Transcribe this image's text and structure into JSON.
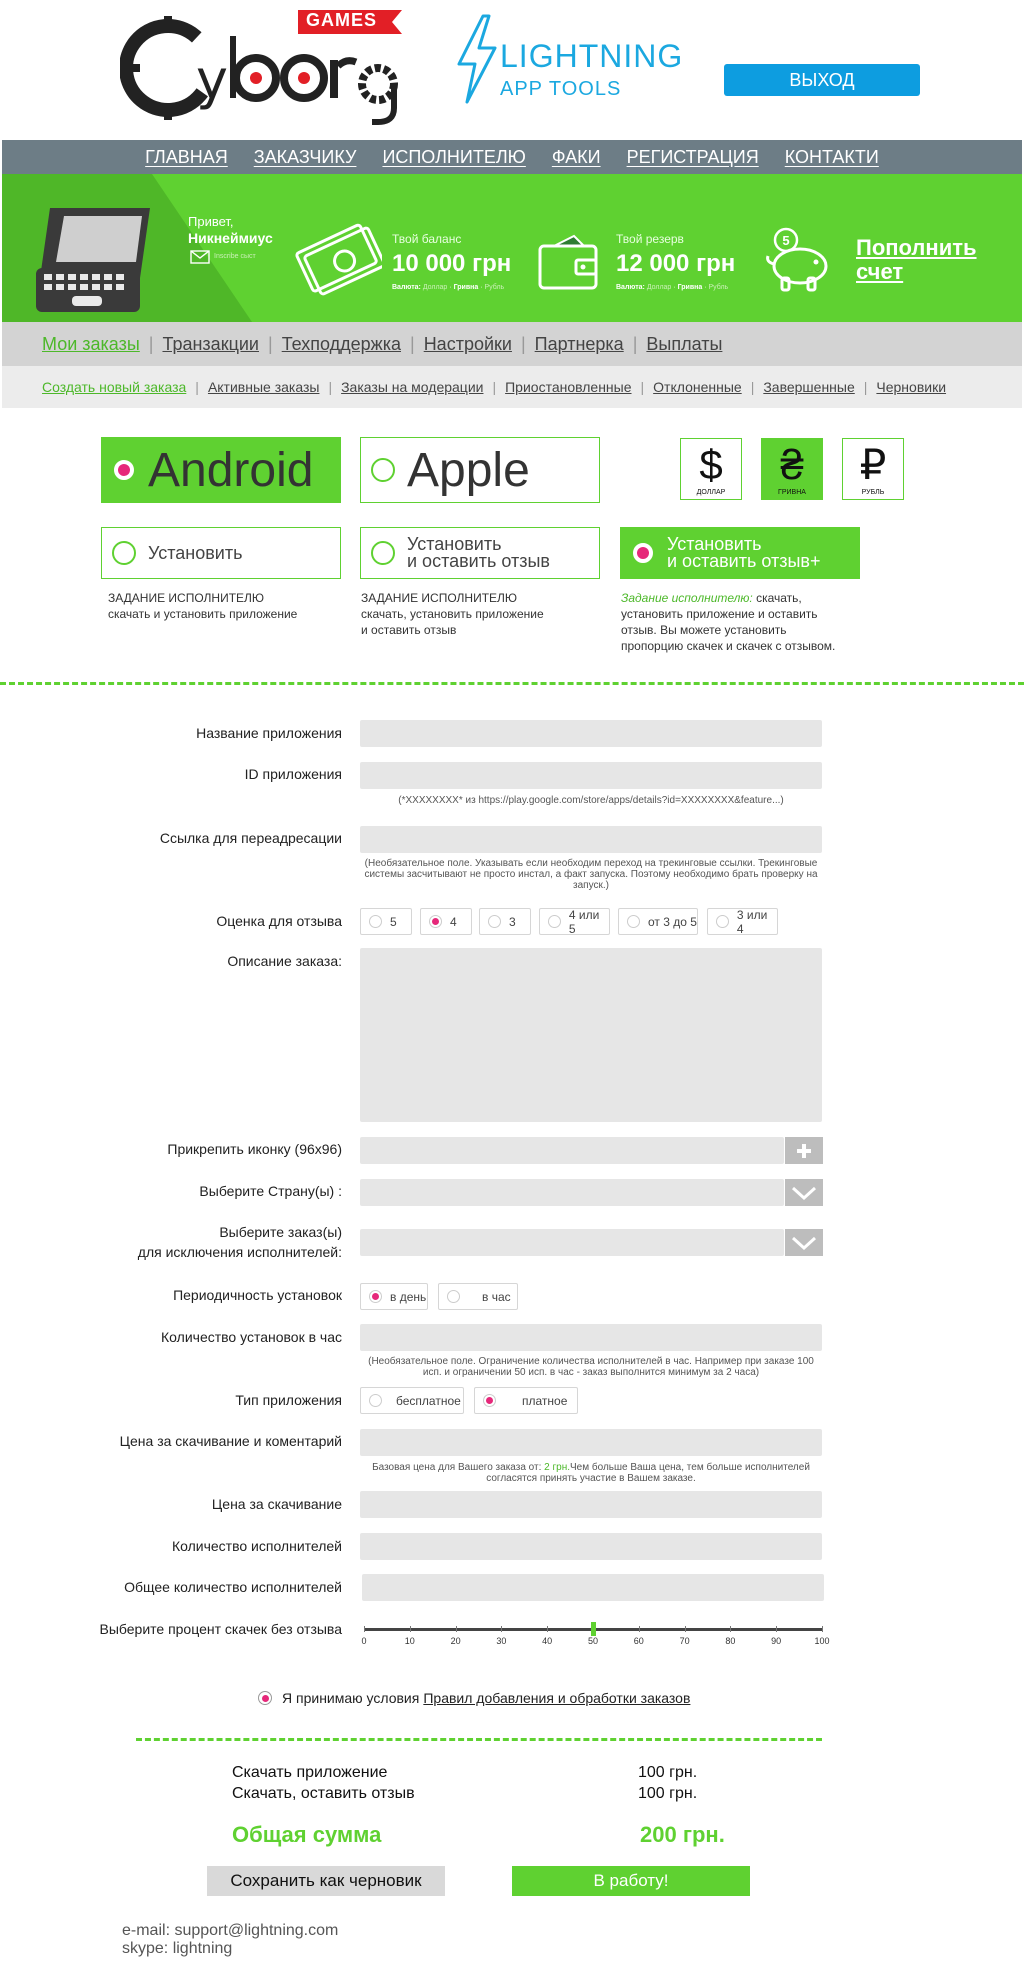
{
  "header": {
    "cyborg_logo_text": "Cyborg",
    "cyborg_logo_badge": "GAMES",
    "lightning_title": "LIGHTNING",
    "lightning_subtitle": "APP TOOLS",
    "logout_label": "ВЫХОД",
    "accent_color": "#1ba8e0"
  },
  "nav": {
    "items": [
      "ГЛАВНАЯ",
      "ЗАКАЗЧИКУ",
      "ИСПОЛНИТЕЛЮ",
      "ФАКИ",
      "РЕГИСТРАЦИЯ",
      "КОНТАКТИ"
    ]
  },
  "profile": {
    "greeting": "Привет,",
    "nickname": "Никнеймиус",
    "mail_caption": "Inscribe сыст"
  },
  "balance": {
    "label": "Твой баланс",
    "value": "10 000 грн",
    "currency_prefix": "Валюта:",
    "currency_opt1": "Доллар",
    "currency_opt2": "Гривна",
    "currency_opt3": "Рубль"
  },
  "reserve": {
    "label": "Твой резерв",
    "value": "12 000 грн",
    "currency_prefix": "Валюта:",
    "currency_opt1": "Доллар",
    "currency_opt2": "Гривна",
    "currency_opt3": "Рубль",
    "piggy_badge": "5"
  },
  "topup_label": "Пополнить счет",
  "subnav1": {
    "items": [
      "Мои заказы",
      "Транзакции",
      "Техподдержка",
      "Настройки",
      "Партнерка",
      "Выплаты"
    ]
  },
  "subnav2": {
    "items": [
      "Создать новый заказа",
      "Активные заказы",
      "Заказы на модерации",
      "Приостановленные",
      "Отклоненные",
      "Завершенные",
      "Черновики"
    ]
  },
  "platforms": {
    "android": "Android",
    "apple": "Apple",
    "selected": "Android"
  },
  "currencies": [
    {
      "symbol": "$",
      "name": "ДОЛЛАР",
      "selected": false
    },
    {
      "symbol": "₴",
      "name": "ГРИВНА",
      "selected": true
    },
    {
      "symbol": "₽",
      "name": "РУБЛЬ",
      "selected": false
    }
  ],
  "tasks": {
    "t1_label": "Установить",
    "t2_line1": "Установить",
    "t2_line2": "и оставить отзыв",
    "t3_line1": "Установить",
    "t3_line2": "и оставить отзыв+",
    "t1_desc_head": "ЗАДАНИЕ ИСПОЛНИТЕЛЮ",
    "t1_desc_body": "скачать и установить приложение",
    "t2_desc_head": "ЗАДАНИЕ ИСПОЛНИТЕЛЮ",
    "t2_desc_body1": "скачать, установить приложение",
    "t2_desc_body2": "и оставить отзыв",
    "t3_desc_head": "Задание исполнителю:",
    "t3_desc_body1": " скачать,",
    "t3_desc_body2": "установить приложение  и оставить",
    "t3_desc_body3": "отзыв. Вы можете  установить",
    "t3_desc_body4": "пропорцию скачек и скачек с отзывом."
  },
  "form": {
    "app_name_label": "Название приложения",
    "app_id_label": "ID приложения",
    "app_id_note": "(*XXXXXXXX* из https://play.google.com/store/apps/details?id=XXXXXXXX&feature...)",
    "redirect_label": "Ссылка для переадресации",
    "redirect_note": "(Необязательное поле. Указывать если необходим переход на трекинговые ссылки. Трекинговые системы засчитывают не просто инстал, а факт запуска. Поэтому необходимо брать проверку на запуск.)",
    "rating_label": "Оценка для отзыва",
    "rating_options": [
      "5",
      "4",
      "3",
      "4 или 5",
      "от 3 до 5",
      "3 или 4"
    ],
    "rating_selected": "4",
    "description_label": "Описание заказа:",
    "icon_label": "Прикрепить иконку (96х96)",
    "country_label": "Выберите Страну(ы) :",
    "exclude_label_line1": "Выберите заказ(ы)",
    "exclude_label_line2": "для исключения исполнителей:",
    "periodicity_label": "Периодичность установок",
    "periodicity_options": [
      "в день",
      "в час"
    ],
    "periodicity_selected": "в день",
    "per_hour_label": "Количество установок в час",
    "per_hour_note": "(Необязательное поле. Ограничение количества исполнителей в час. Например при заказе 100 исп. и ограничении 50 исп. в час - заказ выполнится минимум за 2 часа)",
    "app_type_label": "Тип приложения",
    "app_type_options": [
      "бесплатное",
      "платное"
    ],
    "app_type_selected": "платное",
    "price_comment_label": "Цена  за скачивание и коментарий",
    "price_note_pre": "Базовая цена для Вашего заказа от:",
    "price_note_value": " 2 грн.",
    "price_note_post": "Чем больше Ваша цена, тем больше исполнителей согласятся принять участие в Вашем заказе.",
    "price_download_label": "Цена за скачивание",
    "executors_label": "Количество исполнителей",
    "total_executors_label": "Общее количество исполнителей",
    "percent_label": "Выберите процент скачек без отзыва",
    "percent_ticks": [
      "0",
      "10",
      "20",
      "30",
      "40",
      "50",
      "60",
      "70",
      "80",
      "90",
      "100"
    ],
    "percent_value": 50
  },
  "agree": {
    "text": "Я принимаю условия",
    "link": "Правил добавления и обработки заказов"
  },
  "summary": {
    "line1_label": "Скачать приложение",
    "line1_value": "100 грн.",
    "line2_label": "Скачать, оставить отзыв",
    "line2_value": "100 грн.",
    "total_label": "Общая сумма",
    "total_value": "200 грн.",
    "draft_button": "Сохранить как черновик",
    "go_button": "В работу!"
  },
  "footer": {
    "email": "e-mail: support@lightning.com",
    "skype": "skype: lightning"
  },
  "colors": {
    "green": "#5fd131",
    "nav_bg": "#6d7d86",
    "blue": "#0d9de0",
    "pink_dot": "#e6287a"
  }
}
